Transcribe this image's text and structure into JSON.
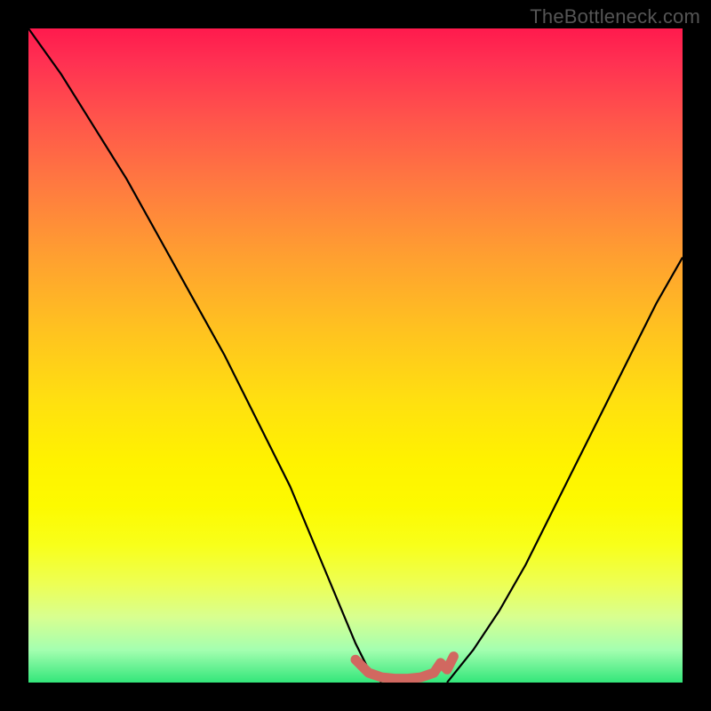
{
  "attribution": "TheBottleneck.com",
  "chart_data": {
    "type": "line",
    "title": "",
    "xlabel": "",
    "ylabel": "",
    "xlim": [
      0,
      100
    ],
    "ylim": [
      0,
      100
    ],
    "series": [
      {
        "name": "left-curve",
        "x": [
          0,
          5,
          10,
          15,
          20,
          25,
          30,
          35,
          40,
          45,
          50,
          52,
          54
        ],
        "values": [
          100,
          93,
          85,
          77,
          68,
          59,
          50,
          40,
          30,
          18,
          6,
          2,
          0
        ],
        "color": "#000000"
      },
      {
        "name": "right-curve",
        "x": [
          64,
          68,
          72,
          76,
          80,
          84,
          88,
          92,
          96,
          100
        ],
        "values": [
          0,
          5,
          11,
          18,
          26,
          34,
          42,
          50,
          58,
          65
        ],
        "color": "#000000"
      },
      {
        "name": "optimum-marker",
        "x": [
          50,
          52,
          54,
          56,
          58,
          60,
          62,
          63,
          64,
          65
        ],
        "values": [
          3.5,
          1.5,
          0.8,
          0.6,
          0.6,
          0.8,
          1.5,
          3.0,
          2.0,
          4.0
        ],
        "color": "#d16860"
      }
    ],
    "colors": {
      "gradient_top": "#ff1a4d",
      "gradient_mid": "#fff200",
      "gradient_bottom": "#33e67a",
      "frame": "#000000",
      "marker": "#d16860"
    }
  }
}
